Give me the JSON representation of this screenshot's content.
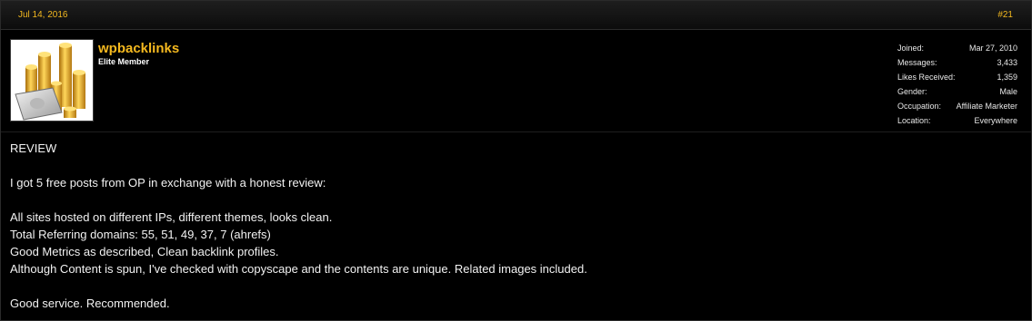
{
  "post": {
    "date": "Jul 14, 2016",
    "number": "#21"
  },
  "user": {
    "name": "wpbacklinks",
    "title": "Elite Member",
    "avatar_icon": "gold-coins-money-icon",
    "stats": [
      {
        "label": "Joined:",
        "value": "Mar 27, 2010"
      },
      {
        "label": "Messages:",
        "value": "3,433"
      },
      {
        "label": "Likes Received:",
        "value": "1,359"
      },
      {
        "label": "Gender:",
        "value": "Male"
      },
      {
        "label": "Occupation:",
        "value": "Affiliate Marketer"
      },
      {
        "label": "Location:",
        "value": "Everywhere"
      }
    ]
  },
  "message": {
    "lines": [
      "REVIEW",
      "",
      "I got 5 free posts from OP in exchange with a honest review:",
      "",
      "All sites hosted on different IPs, different themes, looks clean.",
      "Total Referring domains: 55, 51, 49, 37, 7 (ahrefs)",
      "Good Metrics as described, Clean backlink profiles.",
      "Although Content is spun, I've checked with copyscape and the contents are unique. Related images included.",
      "",
      "Good service. Recommended."
    ]
  },
  "colors": {
    "background": "#000000",
    "accent": "#f3b81f",
    "text": "#f2f2f2"
  }
}
